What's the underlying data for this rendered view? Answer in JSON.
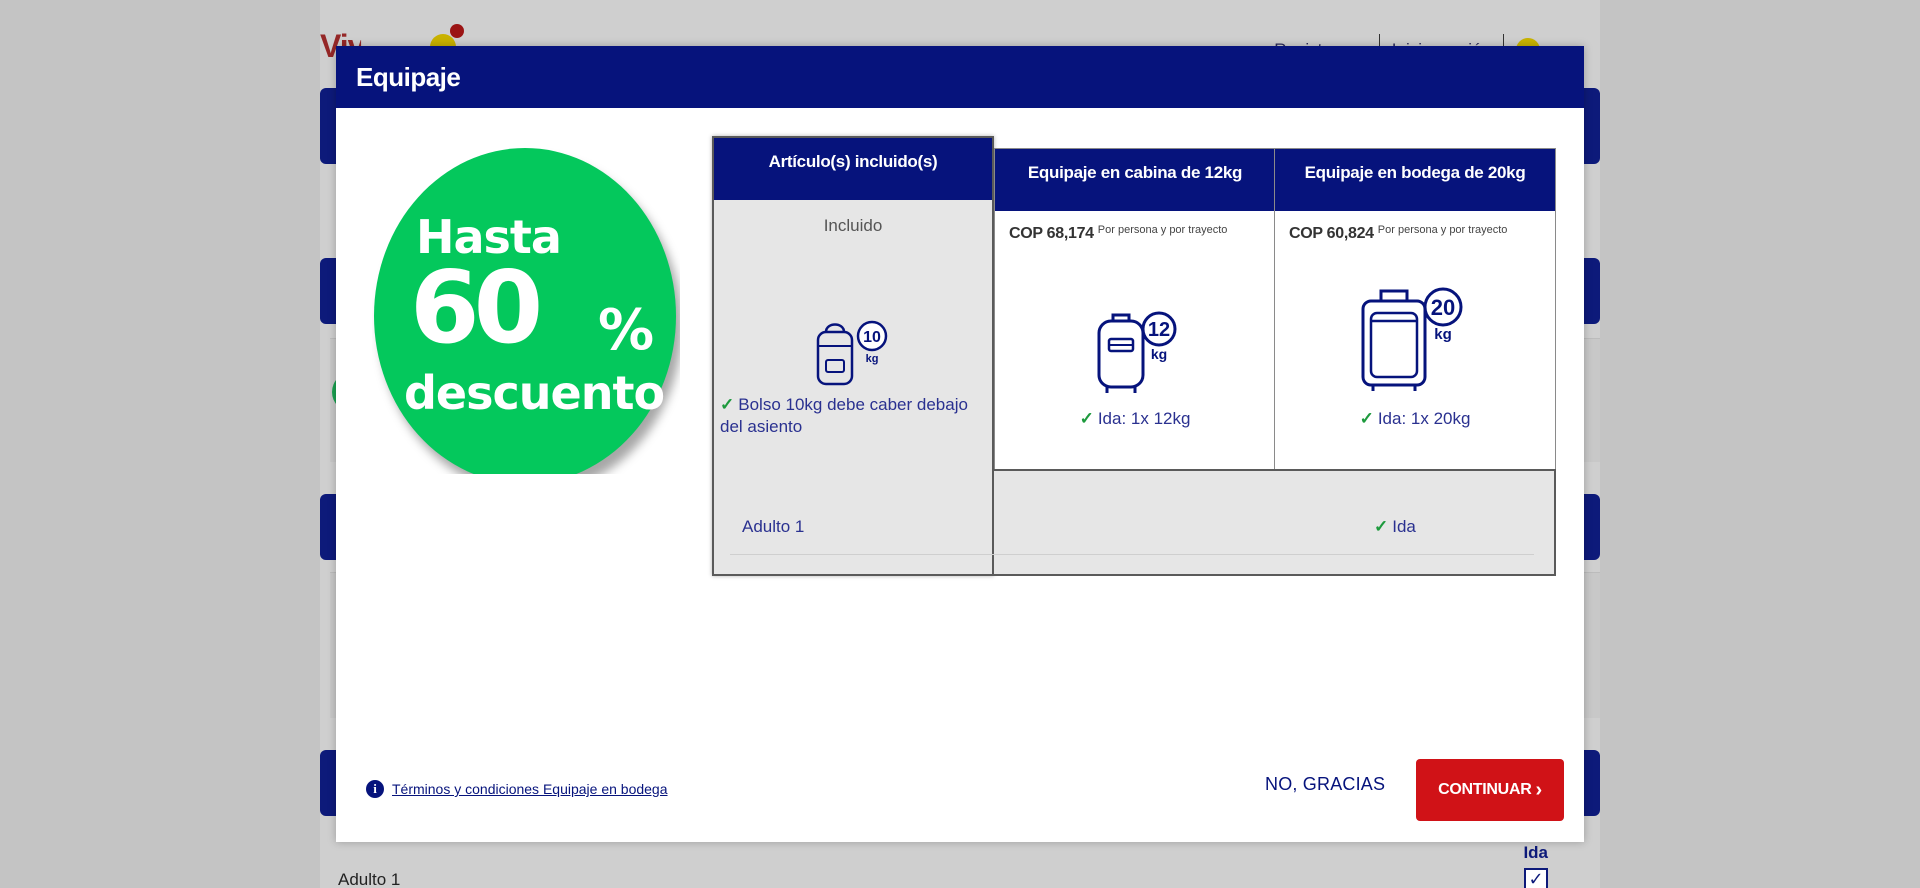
{
  "background": {
    "logo": "VivaAir",
    "top_links": [
      "Registrarme",
      "Iniciar sesión"
    ],
    "bottom_passenger": "Adulto 1",
    "bottom_ida": "Ida",
    "bottom_check": "✓"
  },
  "modal": {
    "title": "Equipaje",
    "promo": {
      "line1": "Hasta",
      "line2": "60",
      "percent": "%",
      "line3": "descuento",
      "color": "#04c85c"
    },
    "included": {
      "header": "Artículo(s) incluido(s)",
      "status": "Incluido",
      "icon": "backpack-10kg-icon",
      "icon_weight": "10",
      "icon_unit": "kg",
      "check": "✓",
      "description": "Bolso 10kg debe caber debajo del asiento"
    },
    "options": [
      {
        "header": "Equipaje en cabina de 12kg",
        "price": "COP 68,174",
        "price_note": "Por persona y por trayecto",
        "icon": "cabin-bag-12kg-icon",
        "icon_weight": "12",
        "icon_unit": "kg",
        "check": "✓",
        "label": "Ida: 1x 12kg"
      },
      {
        "header": "Equipaje en bodega de 20kg",
        "price": "COP 60,824",
        "price_note": "Por persona y por trayecto",
        "icon": "checked-suitcase-20kg-icon",
        "icon_weight": "20",
        "icon_unit": "kg",
        "check": "✓",
        "label": "Ida: 1x 20kg"
      }
    ],
    "passenger": {
      "name": "Adulto 1",
      "check": "✓",
      "leg": "Ida"
    },
    "footer": {
      "info_icon": "i",
      "terms": "Términos y condiciones Equipaje en bodega",
      "decline": "NO, GRACIAS",
      "continue": "CONTINUAR",
      "continue_chevron": "›"
    },
    "colors": {
      "header": "#06137c",
      "primary_button": "#d01217",
      "check": "#1d9a3d"
    }
  }
}
